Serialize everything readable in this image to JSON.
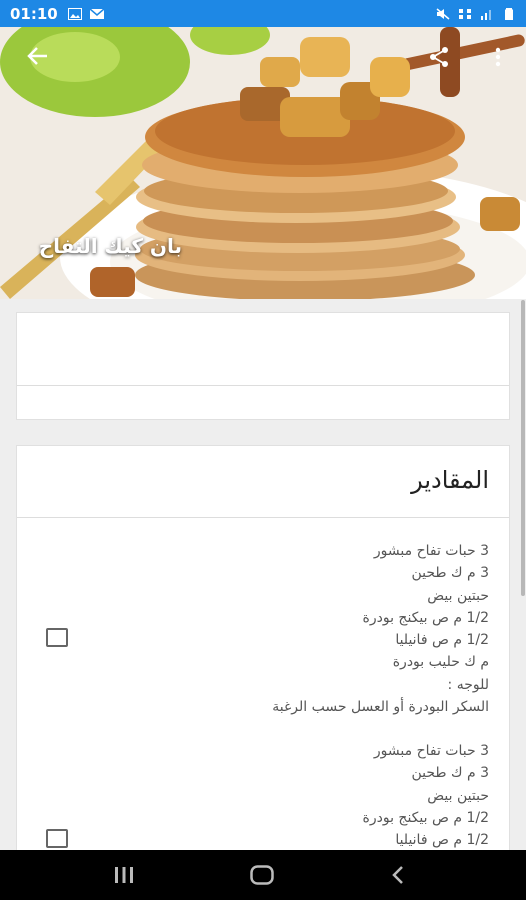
{
  "status_bar": {
    "time": "01:10",
    "left_icons": [
      "image-icon",
      "mail-icon"
    ],
    "right_icons": [
      "mute-icon",
      "data-icon",
      "signal-icon",
      "battery-icon"
    ]
  },
  "header": {
    "title": "بان كيك التفاح",
    "back_icon": "arrow-left-icon",
    "share_icon": "share-icon",
    "more_icon": "more-vert-icon"
  },
  "ingredients": {
    "title": "المقادير",
    "items": [
      {
        "checked": false,
        "lines": [
          "3 حبات تفاح مبشور",
          "3 م ك طحين",
          "حبتين بيض",
          "1/2 م ص بيكنج بودرة",
          "1/2 م ص فانيليا",
          "م ك حليب بودرة",
          "للوجه :",
          "السكر البودرة أو العسل حسب الرغبة"
        ]
      },
      {
        "checked": false,
        "lines": [
          "3 حبات تفاح مبشور",
          "3 م ك طحين",
          "حبتين بيض",
          "1/2 م ص بيكنج بودرة",
          "1/2 م ص فانيليا"
        ]
      }
    ]
  },
  "nav_bar": {
    "recents_icon": "recents-icon",
    "home_icon": "home-icon",
    "back_icon": "nav-back-icon"
  },
  "colors": {
    "status_bar": "#1e88e5",
    "card": "#ffffff",
    "background": "#eeeeee",
    "nav_bar": "#000000"
  }
}
